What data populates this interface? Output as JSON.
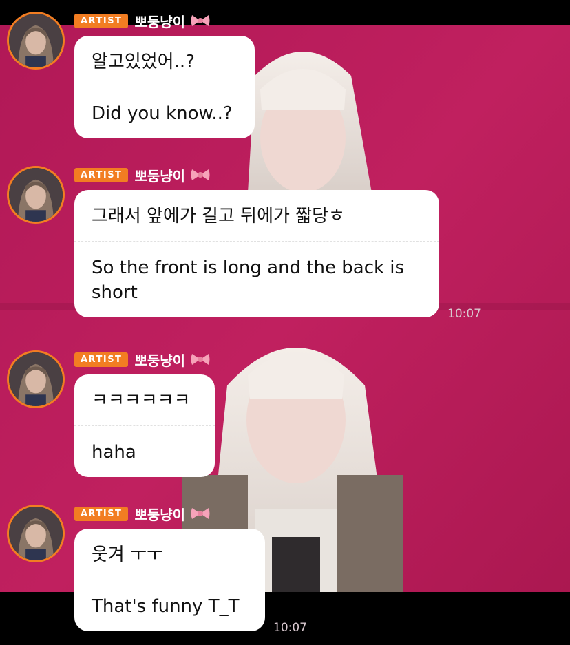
{
  "colors": {
    "background": "#b51a59",
    "badge": "#f27d22",
    "bubble": "#ffffff",
    "timestamp": "#d9c8cf"
  },
  "messages": [
    {
      "badge": "ARTIST",
      "username": "뽀둥냥이",
      "username_icon": "ribbon-bow-icon",
      "original": "알고있었어..?",
      "translation": "Did you know..?",
      "time": ""
    },
    {
      "badge": "ARTIST",
      "username": "뽀둥냥이",
      "username_icon": "ribbon-bow-icon",
      "original": "그래서 앞에가 길고 뒤에가 짧당ㅎ",
      "translation": "So the front is long and the back is short",
      "time": "10:07"
    },
    {
      "badge": "ARTIST",
      "username": "뽀둥냥이",
      "username_icon": "ribbon-bow-icon",
      "original": "ㅋㅋㅋㅋㅋㅋ",
      "translation": "haha",
      "time": ""
    },
    {
      "badge": "ARTIST",
      "username": "뽀둥냥이",
      "username_icon": "ribbon-bow-icon",
      "original": "웃겨 ㅜㅜ",
      "translation": "That's funny T_T",
      "time": "10:07"
    }
  ]
}
